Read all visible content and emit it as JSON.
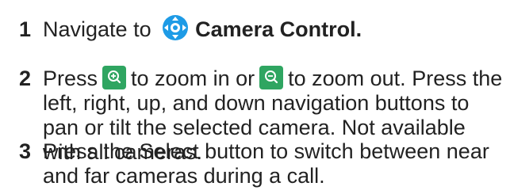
{
  "steps": [
    {
      "number": "1",
      "prefix": "Navigate to",
      "icon": "camera-control-icon",
      "target": "Camera Control."
    },
    {
      "number": "2",
      "press": "Press",
      "zoom_in_icon": "zoom-in-icon",
      "zoom_in_text": "to zoom in or",
      "zoom_out_icon": "zoom-out-icon",
      "zoom_out_text": "to zoom out. Press the left, right, up, and down navigation buttons to pan or tilt the selected camera. Not available with all cameras."
    },
    {
      "number": "3",
      "text": "Press the Select button to switch between near and far cameras during a call."
    }
  ],
  "colors": {
    "text": "#222222",
    "camera_icon": "#1e9be6",
    "zoom_button": "#2fa561"
  }
}
